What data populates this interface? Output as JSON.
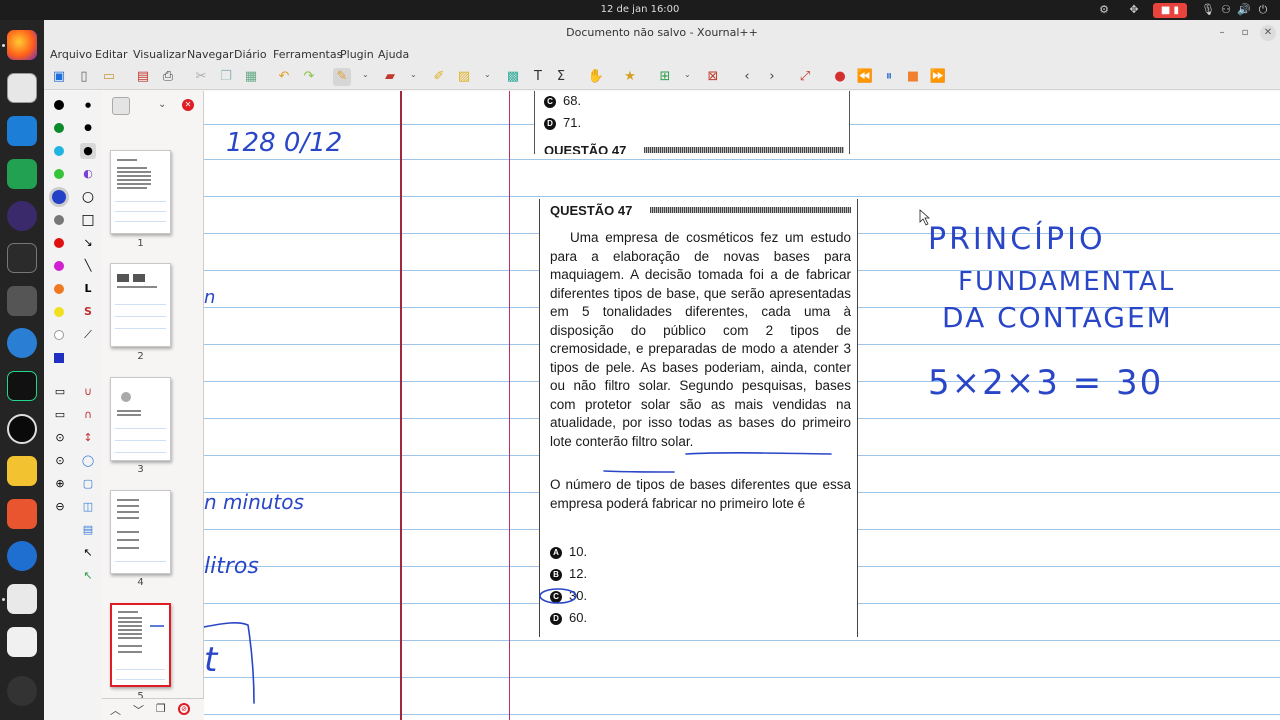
{
  "system": {
    "clock": "12 de jan  16:00"
  },
  "window": {
    "title": "Documento não salvo - Xournal++"
  },
  "menu": [
    "Arquivo",
    "Editar",
    "Visualizar",
    "Navegar",
    "Diário",
    "Ferramentas",
    "Plugin",
    "Ajuda"
  ],
  "sidebar": {
    "pages": [
      "1",
      "2",
      "3",
      "4",
      "5"
    ],
    "selected_page": "5"
  },
  "document": {
    "top_crop": {
      "options": [
        {
          "letter": "C",
          "text": "68."
        },
        {
          "letter": "D",
          "text": "71."
        }
      ],
      "cut_title": "QUESTÃO 47"
    },
    "question": {
      "title": "QUESTÃO 47",
      "body": "Uma empresa de cosméticos fez um estudo para a elaboração de novas bases para maquiagem. A decisão tomada foi a de fabricar diferentes tipos de base, que serão apresentadas em 5 tonalidades diferentes, cada uma à disposição do público com 2 tipos de cremosidade, e preparadas de modo a atender 3 tipos de pele. As bases poderiam, ainda, conter ou não filtro solar. Segundo pesquisas, bases com protetor solar são as mais vendidas na atualidade, por isso todas as bases do primeiro lote conterão filtro solar.",
      "ask": "O número de tipos de bases diferentes que essa empresa poderá fabricar no primeiro lote é",
      "options": [
        {
          "letter": "A",
          "text": "10."
        },
        {
          "letter": "B",
          "text": "12."
        },
        {
          "letter": "C",
          "text": "30."
        },
        {
          "letter": "D",
          "text": "60."
        }
      ]
    },
    "handwriting": {
      "left_fragments": [
        "128 0/12",
        "n",
        "n minutos",
        "litros",
        "t"
      ],
      "right_notes": [
        "PRINCÍPIO",
        "FUNDAMENTAL",
        "DA CONTAGEM",
        "5×2×3 = 30"
      ]
    }
  },
  "colors": {
    "ruled_line": "#9ec4e8",
    "margin": "#a4283d",
    "ink_blue": "#2946c7",
    "selected_page_border": "#e01b24"
  }
}
